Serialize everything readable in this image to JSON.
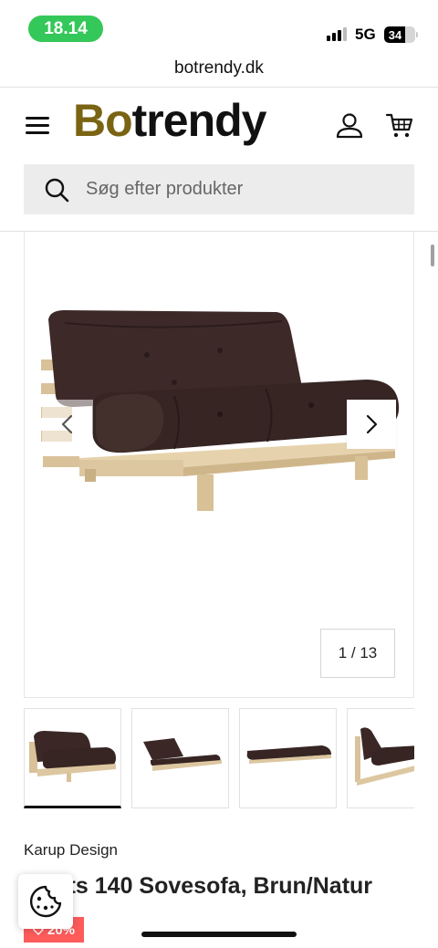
{
  "status_bar": {
    "time": "18.14",
    "network": "5G",
    "battery": "34",
    "battery_level": 0.34
  },
  "browser": {
    "url": "botrendy.dk"
  },
  "header": {
    "logo_accent": "Bo",
    "logo_rest": "trendy",
    "search_placeholder": "Søg efter produkter",
    "icons": [
      "menu-icon",
      "user-icon",
      "cart-icon",
      "search-icon"
    ]
  },
  "gallery": {
    "counter": "1 / 13",
    "prev_icon": "chevron-left-icon",
    "next_icon": "chevron-right-icon",
    "thumbnail_count": 4,
    "active_thumbnail": 1
  },
  "product": {
    "brand": "Karup Design",
    "title": "Roots 140 Sovesofa, Brun/Natur",
    "discount": "20%"
  },
  "colors": {
    "logo_accent": "#7a6414",
    "time_pill": "#34c759",
    "discount_badge": "#ff5b5b",
    "search_bg": "#ececec",
    "sofa_cushion": "#3b2826",
    "sofa_frame": "#dcc7a0"
  }
}
